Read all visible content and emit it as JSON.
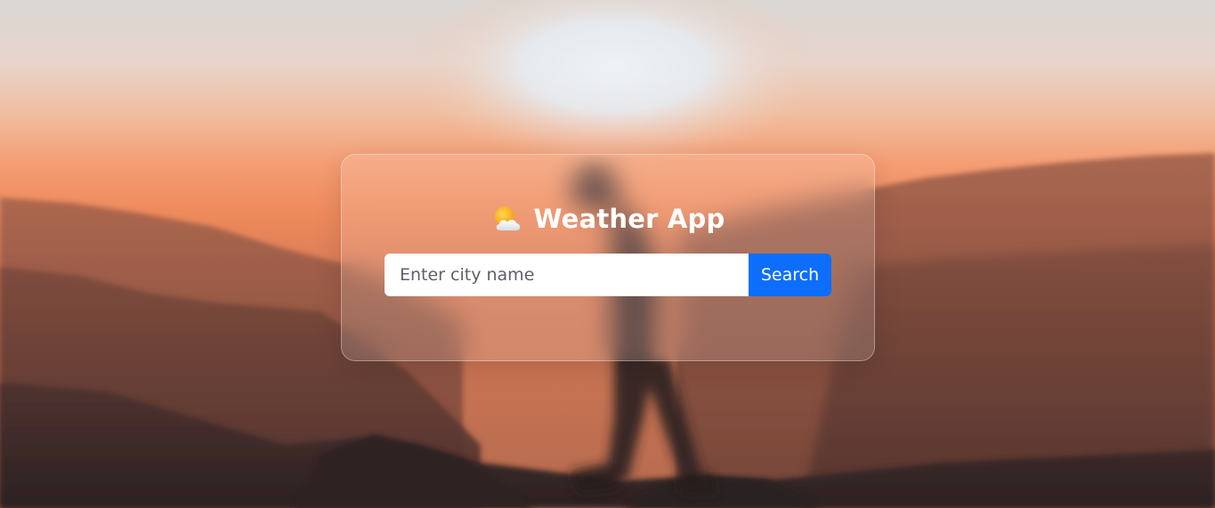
{
  "app": {
    "title": "Weather App",
    "icon": "sun-behind-cloud-icon"
  },
  "search": {
    "placeholder": "Enter city name",
    "value": "",
    "button_label": "Search"
  },
  "colors": {
    "button_bg": "#0d6efd",
    "button_text": "#ffffff",
    "title_text": "#ffffff",
    "input_bg": "#ffffff"
  }
}
